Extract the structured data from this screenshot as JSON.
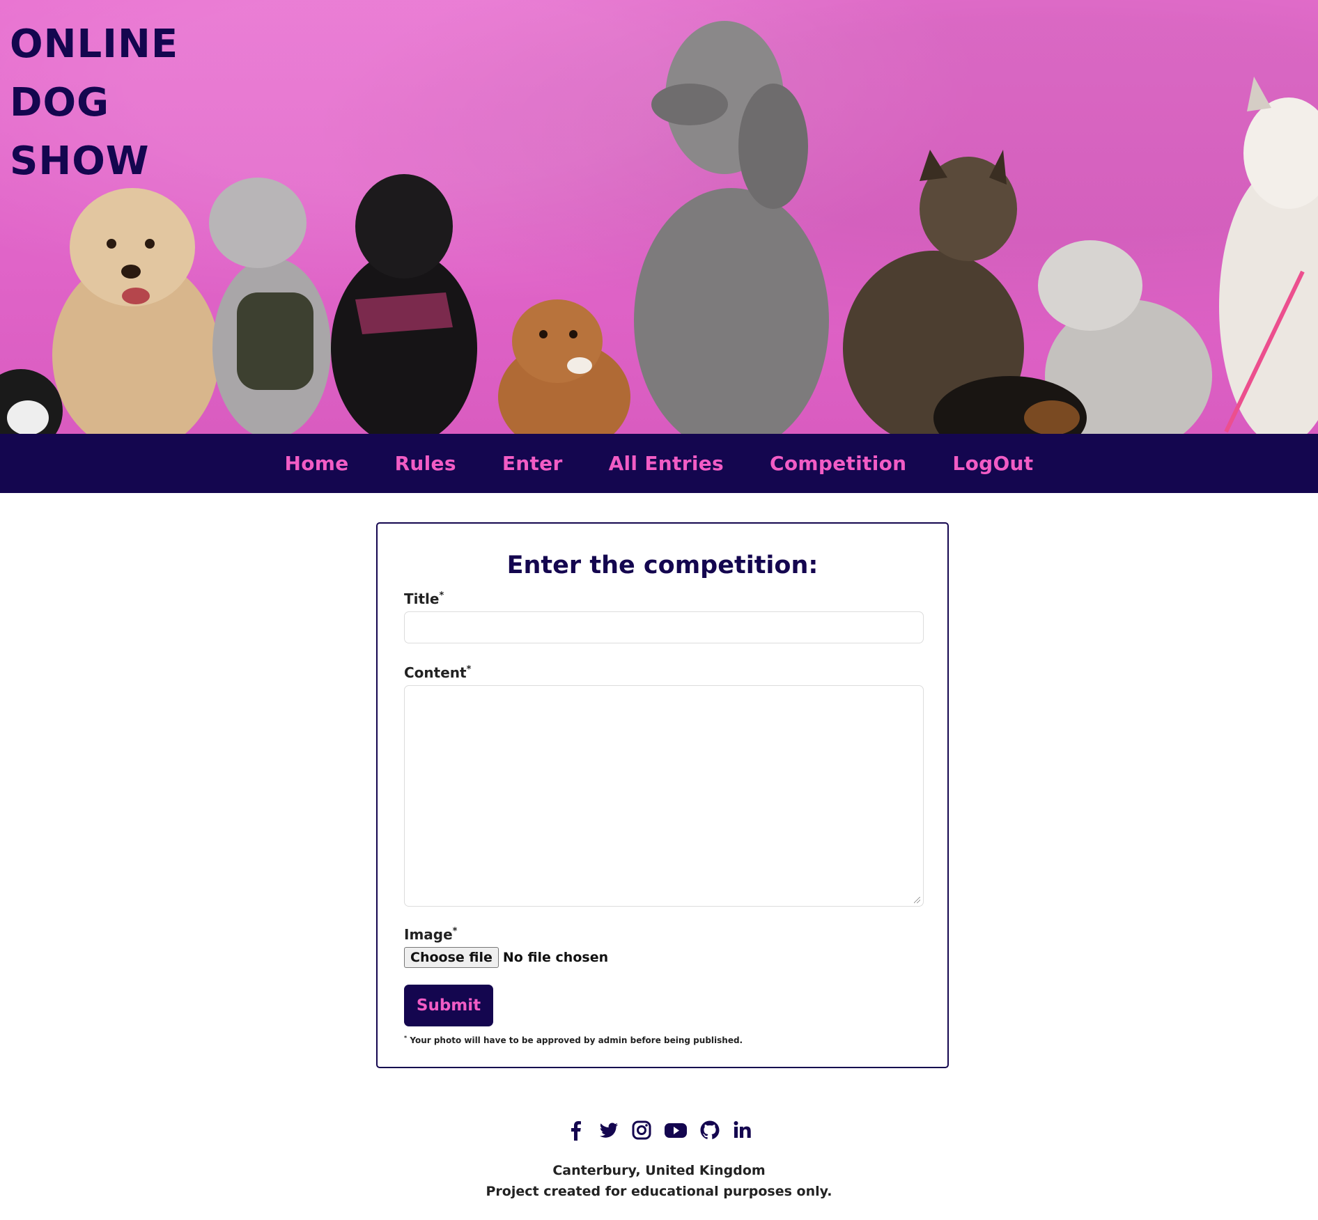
{
  "hero": {
    "title_lines": [
      "ONLINE",
      "DOG",
      "SHOW"
    ]
  },
  "nav": {
    "items": [
      "Home",
      "Rules",
      "Enter",
      "All Entries",
      "Competition",
      "LogOut"
    ]
  },
  "form": {
    "heading": "Enter the competition:",
    "title_label": "Title",
    "title_value": "",
    "content_label": "Content",
    "content_value": "",
    "image_label": "Image",
    "required_marker": "*",
    "choose_file_label": "Choose file",
    "no_file_text": "No file chosen",
    "submit_label": "Submit",
    "note_marker": "*",
    "note": " Your photo will have to be approved by admin before being published."
  },
  "footer": {
    "social_icons": [
      "facebook-icon",
      "twitter-icon",
      "instagram-icon",
      "youtube-icon",
      "github-icon",
      "linkedin-icon"
    ],
    "location": "Canterbury, United Kingdom",
    "disclaimer": "Project created for educational purposes only."
  },
  "colors": {
    "navy": "#14064f",
    "pink": "#f25cc5",
    "hero_background": "#e064c8"
  }
}
